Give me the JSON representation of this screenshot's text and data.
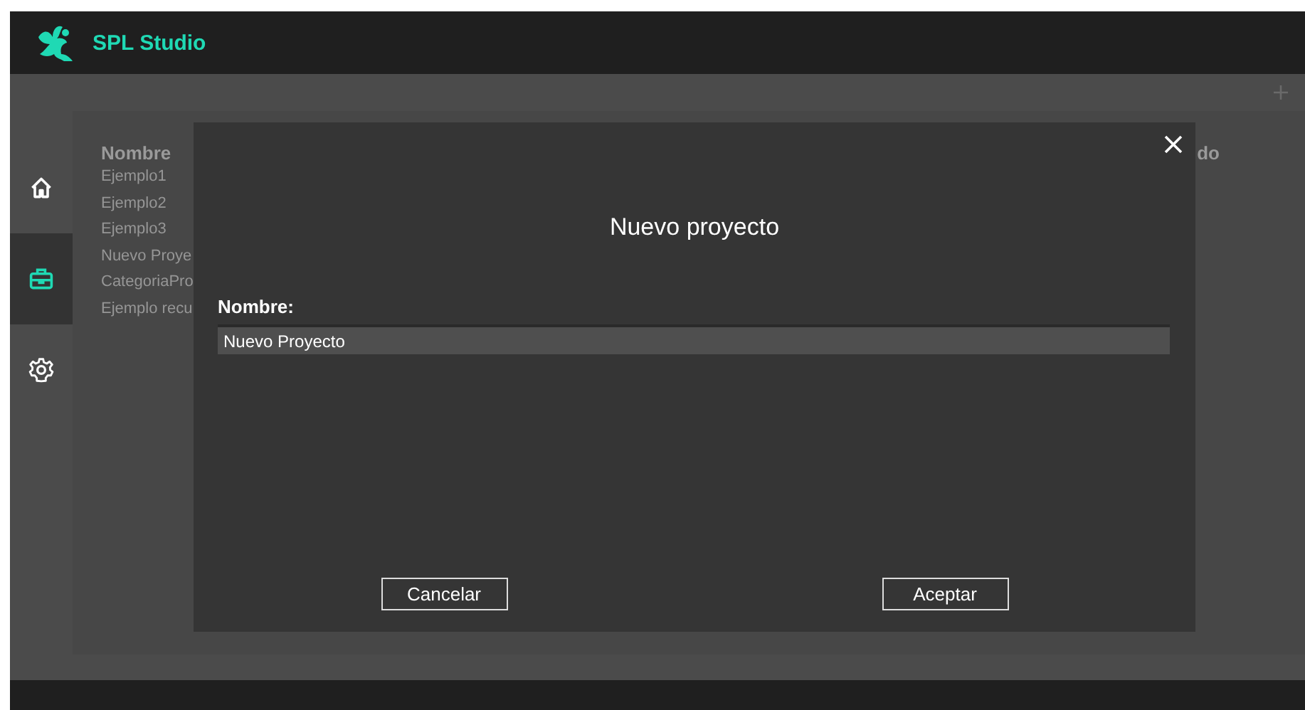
{
  "app": {
    "title": "SPL Studio"
  },
  "sidebar": {
    "items": [
      {
        "selected": false
      },
      {
        "selected": true
      },
      {
        "selected": false
      }
    ]
  },
  "table": {
    "columns": [
      "Nombre",
      "do"
    ],
    "rows": [
      "Ejemplo1",
      "Ejemplo2",
      "Ejemplo3",
      "Nuevo Proye",
      "CategoriaPro",
      "Ejemplo recu"
    ]
  },
  "dialog": {
    "title": "Nuevo proyecto",
    "field_label": "Nombre:",
    "field_value": "Nuevo Proyecto",
    "buttons": [
      "Cancelar",
      "Aceptar"
    ]
  }
}
